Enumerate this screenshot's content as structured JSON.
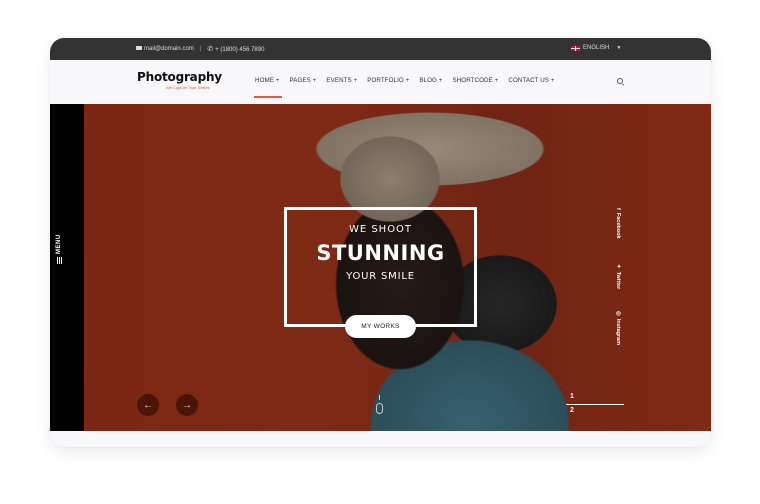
{
  "topbar": {
    "email": "mail@domain.com",
    "phone": "+ (1800) 456 7890",
    "language": "ENGLISH",
    "icons": {
      "email": "envelope-icon",
      "phone": "phone-icon",
      "flag": "uk-flag-icon",
      "caret": "caret-down-icon"
    }
  },
  "header": {
    "logo_title": "Photography",
    "logo_tagline": "We Capture Your Smiles",
    "menu": [
      {
        "label": "HOME +",
        "active": true
      },
      {
        "label": "PAGES +"
      },
      {
        "label": "EVENTS +"
      },
      {
        "label": "PORTFOLIO +"
      },
      {
        "label": "BLOG +"
      },
      {
        "label": "SHORTCODE +"
      },
      {
        "label": "CONTACT US +"
      }
    ],
    "accent_color": "#e65a3c"
  },
  "sidemenu": {
    "label": "MENU"
  },
  "hero": {
    "line1": "WE SHOOT",
    "line2": "STUNNING",
    "line3": "YOUR SMILE",
    "cta": "MY WORKS",
    "prev_arrow": "←",
    "next_arrow": "→",
    "social": [
      {
        "icon": "f",
        "label": "Facebook"
      },
      {
        "icon": "🐦",
        "label": "Twitter"
      },
      {
        "icon": "◎",
        "label": "Instagram"
      }
    ],
    "pager": {
      "current": "1",
      "total": "2"
    }
  }
}
